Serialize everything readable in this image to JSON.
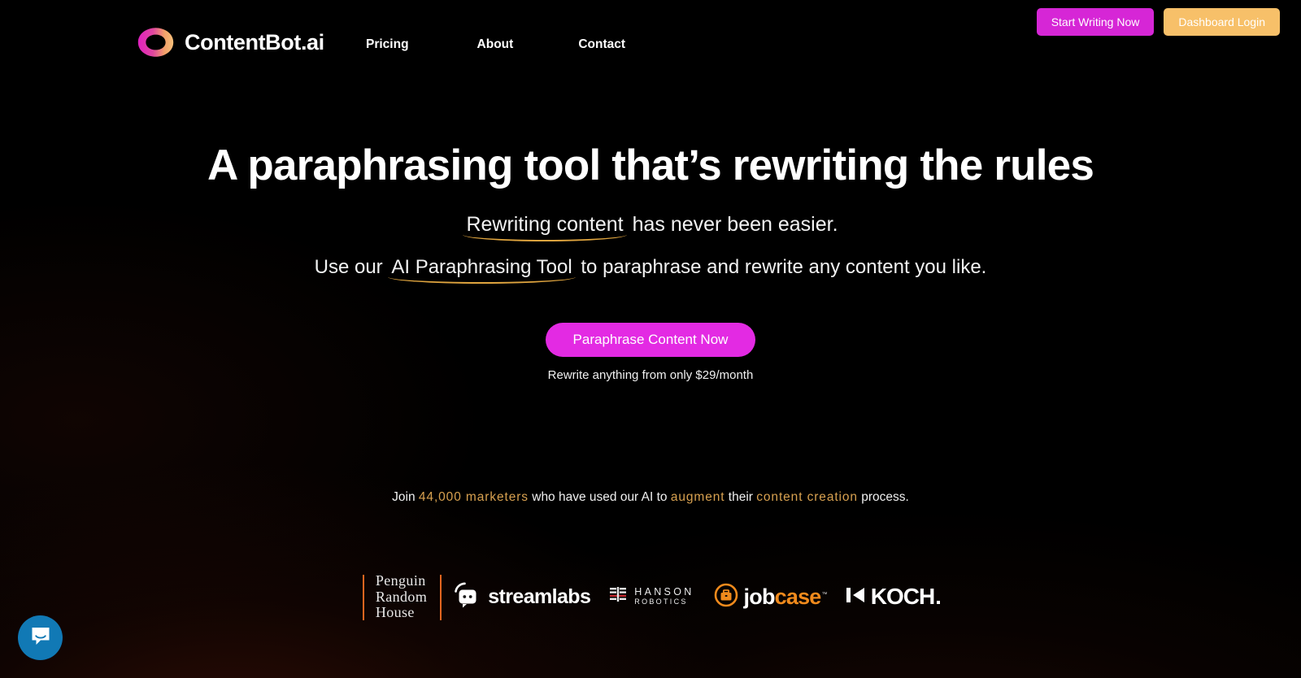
{
  "brand": {
    "name": "ContentBot.ai",
    "logo_gradient_from": "#e020c0",
    "logo_gradient_to": "#f7b267"
  },
  "nav": {
    "items": [
      {
        "label": "Pricing"
      },
      {
        "label": "About"
      },
      {
        "label": "Contact"
      }
    ]
  },
  "header_actions": {
    "start_writing_label": "Start Writing Now",
    "start_writing_color": "#d626d6",
    "dashboard_login_label": "Dashboard Login",
    "dashboard_login_color": "#f7c069"
  },
  "hero": {
    "headline": "A paraphrasing tool that’s rewriting the rules",
    "sub1_highlight": "Rewriting content",
    "sub1_rest": " has never been easier.",
    "sub2_pre": "Use our ",
    "sub2_highlight": "AI Paraphrasing Tool",
    "sub2_post": " to paraphrase and rewrite any content you like.",
    "cta_label": "Paraphrase Content Now",
    "cta_color": "#e32ae3",
    "cta_note": "Rewrite anything from only $29/month",
    "underline_color": "#e0a53f"
  },
  "social_proof": {
    "part1": "Join ",
    "count": "44,000 marketers",
    "part2": " who have used our AI to ",
    "verb": "augment",
    "part3": " their ",
    "topic": "content creation",
    "part4": " process.",
    "accent_color": "#d8a150"
  },
  "logos": {
    "penguin": {
      "name": "Penguin\nRandom\nHouse",
      "rule_color": "#e2651f"
    },
    "streamlabs": {
      "name": "streamlabs"
    },
    "hanson": {
      "line1": "HANSON",
      "line2": "ROBOTICS",
      "accent": "#c0232a"
    },
    "jobcase": {
      "job": "job",
      "case": "case",
      "tm": "™",
      "accent": "#f08a1c"
    },
    "koch": {
      "name": "KOCH"
    }
  },
  "intercom": {
    "label": "Open Intercom Messenger",
    "color": "#1179b5"
  }
}
